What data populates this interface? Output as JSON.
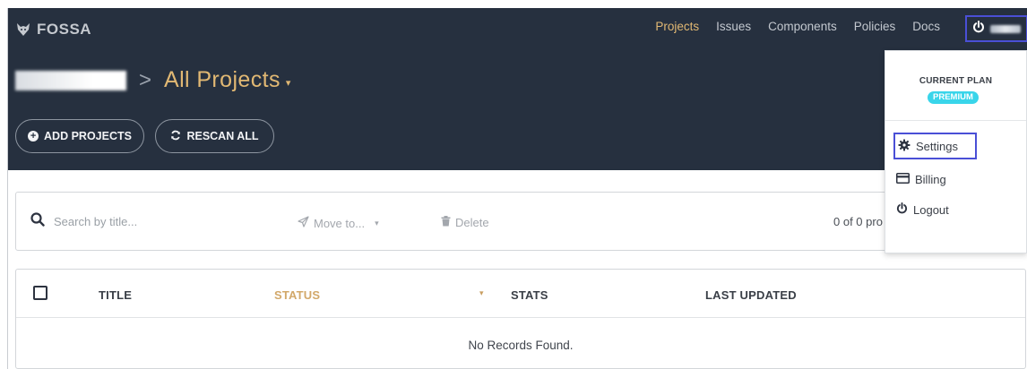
{
  "brand": {
    "name": "FOSSA"
  },
  "nav": {
    "items": [
      "Projects",
      "Issues",
      "Components",
      "Policies",
      "Docs"
    ],
    "active": "Projects"
  },
  "breadcrumb": {
    "separator": ">",
    "title": "All Projects",
    "title_caret": "▾"
  },
  "actions": {
    "add_projects": "ADD PROJECTS",
    "rescan_all": "RESCAN ALL"
  },
  "toolbar": {
    "search_placeholder": "Search by title...",
    "move_to": "Move to...",
    "move_caret": "▾",
    "delete": "Delete",
    "count": "0 of 0 pro"
  },
  "table": {
    "columns": {
      "title": "TITLE",
      "status": "STATUS",
      "sort_caret": "▾",
      "stats": "STATS",
      "last_updated": "LAST UPDATED"
    },
    "empty_message": "No Records Found."
  },
  "user_menu": {
    "plan_label": "CURRENT PLAN",
    "plan_badge": "PREMIUM",
    "items": {
      "settings": "Settings",
      "billing": "Billing",
      "logout": "Logout"
    }
  },
  "colors": {
    "header_bg": "#26303f",
    "accent_gold": "#e1b873",
    "premium_badge": "#39d5ea",
    "highlight_border": "#4a4fd6"
  },
  "icons": {
    "logo": "fox-logo-icon",
    "power": "power-icon",
    "add": "plus-circle-icon",
    "rescan": "refresh-icon",
    "search": "search-icon",
    "move": "send-icon",
    "delete": "trash-icon",
    "settings": "gear-icon",
    "billing": "credit-card-icon",
    "logout": "power-icon"
  }
}
